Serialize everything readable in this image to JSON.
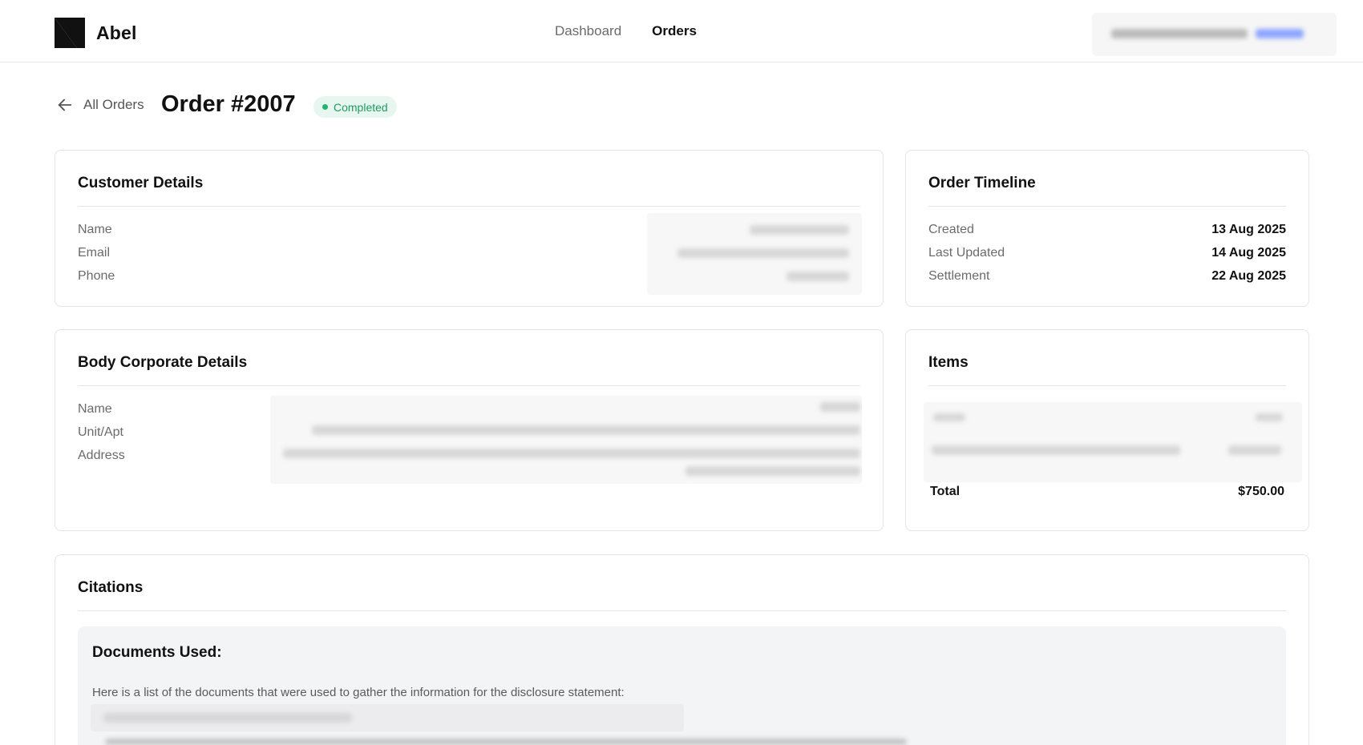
{
  "app": {
    "name": "Abel"
  },
  "nav": {
    "items": [
      {
        "label": "Dashboard",
        "active": false
      },
      {
        "label": "Orders",
        "active": true
      }
    ]
  },
  "header_title": {
    "back_label": "All Orders",
    "order_title": "Order #2007",
    "status": "Completed",
    "status_color": "#1f9a63"
  },
  "customer": {
    "title": "Customer Details",
    "fields": [
      {
        "label": "Name"
      },
      {
        "label": "Email"
      },
      {
        "label": "Phone"
      }
    ]
  },
  "timeline": {
    "title": "Order Timeline",
    "rows": [
      {
        "label": "Created",
        "value": "13 Aug 2025"
      },
      {
        "label": "Last Updated",
        "value": "14 Aug 2025"
      },
      {
        "label": "Settlement",
        "value": "22 Aug 2025"
      }
    ]
  },
  "body_corporate": {
    "title": "Body Corporate Details",
    "fields": [
      {
        "label": "Name"
      },
      {
        "label": "Unit/Apt"
      },
      {
        "label": "Address"
      }
    ]
  },
  "items": {
    "title": "Items",
    "total_label": "Total",
    "total_value": "$750.00"
  },
  "citations": {
    "title": "Citations",
    "docs_heading": "Documents Used:",
    "docs_intro": "Here is a list of the documents that were used to gather the information for the disclosure statement:"
  },
  "colors": {
    "accent_green": "#1fb470",
    "badge_bg": "#e7f7ef",
    "link_blue": "#4a73ff"
  },
  "icons": {
    "back": "arrow-left-icon",
    "logo": "abel-logo"
  }
}
